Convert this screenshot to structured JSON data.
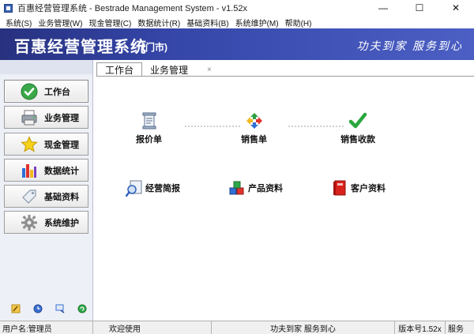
{
  "window": {
    "title": "百惠经营管理系统 - Bestrade Management System - v1.52x",
    "minimize": "—",
    "maximize": "☐",
    "close": "✕"
  },
  "menu": [
    "系统(S)",
    "业务管理(W)",
    "现金管理(C)",
    "数据统计(R)",
    "基础资料(B)",
    "系统维护(M)",
    "帮助(H)"
  ],
  "banner": {
    "title": "百惠经营管理系统",
    "subtitle": "(门市)",
    "slogan": "功夫到家 服务到心",
    "colors": {
      "start": "#27317f",
      "end": "#4c5fc4"
    }
  },
  "sidebar": {
    "items": [
      {
        "label": "工作台",
        "icon": "check-circle-icon"
      },
      {
        "label": "业务管理",
        "icon": "printer-icon"
      },
      {
        "label": "现金管理",
        "icon": "star-icon"
      },
      {
        "label": "数据统计",
        "icon": "bar-chart-icon"
      },
      {
        "label": "基础资料",
        "icon": "tag-icon"
      },
      {
        "label": "系统维护",
        "icon": "gear-icon"
      }
    ],
    "tools": [
      "edit-icon",
      "clock-icon",
      "search-icon",
      "refresh-icon"
    ]
  },
  "tabs": [
    {
      "label": "工作台",
      "active": true
    },
    {
      "label": "业务管理",
      "active": false
    }
  ],
  "tab_close": "×",
  "workspace": {
    "flow": [
      {
        "label": "报价单",
        "icon": "document-icon"
      },
      {
        "label": "销售单",
        "icon": "cycle-arrows-icon"
      },
      {
        "label": "销售收款",
        "icon": "checkmark-icon"
      }
    ],
    "shortcuts": [
      {
        "label": "经营简报",
        "icon": "magnifier-report-icon"
      },
      {
        "label": "产品资料",
        "icon": "cubes-icon"
      },
      {
        "label": "客户资料",
        "icon": "red-book-icon"
      }
    ]
  },
  "status": {
    "user": "用户名:管理员",
    "welcome": "欢迎使用",
    "slogan": "功夫到家 服务到心",
    "version": "版本号1.52x",
    "service": "服务"
  }
}
